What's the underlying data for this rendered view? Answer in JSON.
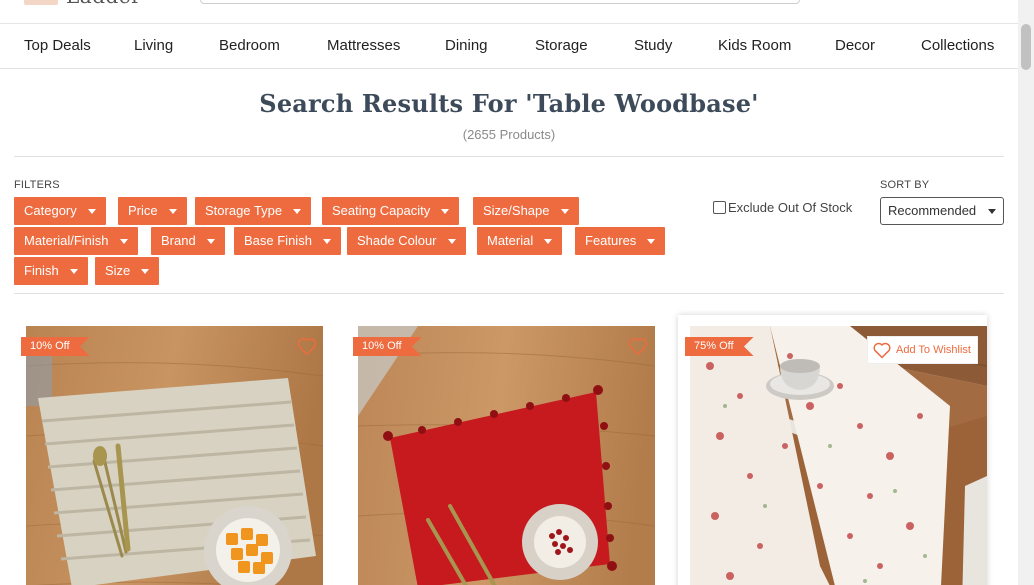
{
  "brand": {
    "logo_text": "Ladder"
  },
  "nav": {
    "items": [
      "Top Deals",
      "Living",
      "Bedroom",
      "Mattresses",
      "Dining",
      "Storage",
      "Study",
      "Kids Room",
      "Decor",
      "Collections"
    ]
  },
  "search": {
    "title": "Search Results For 'Table Woodbase'",
    "count": "(2655 Products)"
  },
  "filters": {
    "label": "FILTERS",
    "buttons": [
      "Category",
      "Price",
      "Storage Type",
      "Seating Capacity",
      "Size/Shape",
      "Material/Finish",
      "Brand",
      "Base Finish",
      "Shade Colour",
      "Material",
      "Features",
      "Finish",
      "Size"
    ]
  },
  "exclude_out_of_stock": {
    "label": "Exclude Out Of Stock",
    "checked": false
  },
  "sort": {
    "label": "SORT BY",
    "selected": "Recommended"
  },
  "products": [
    {
      "discount": "10% Off",
      "wishlisted": false,
      "icon": "heart-outline-icon"
    },
    {
      "discount": "10% Off",
      "wishlisted": false,
      "icon": "heart-outline-icon"
    },
    {
      "discount": "75% Off",
      "wishlist_label": "Add To Wishlist",
      "icon": "heart-outline-icon"
    }
  ],
  "colors": {
    "accent": "#ee6b3f",
    "title": "#3c4a5a",
    "text": "#333333"
  }
}
